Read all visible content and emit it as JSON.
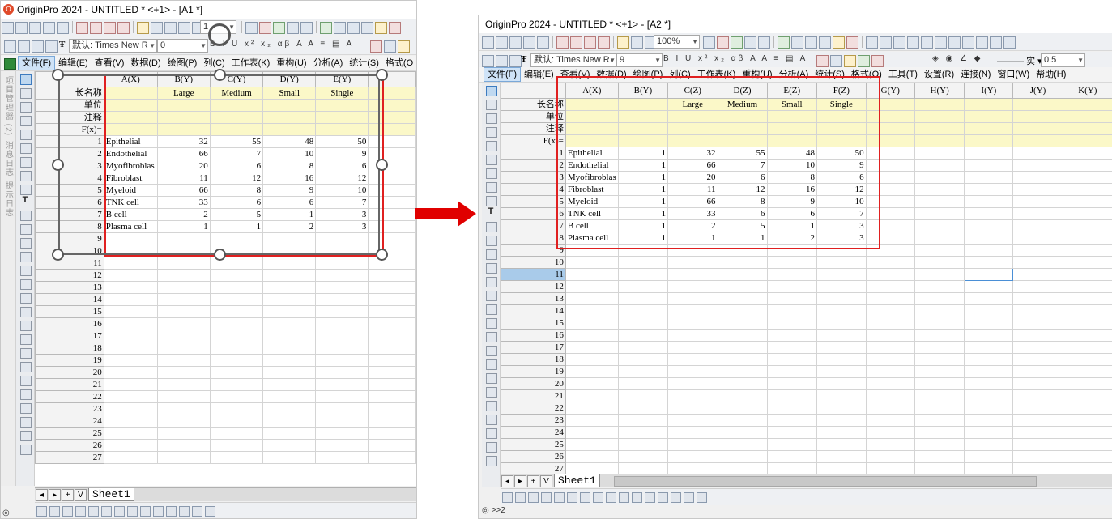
{
  "colors": {
    "arrow": "#e00000",
    "selection_box": "#e02020",
    "meta_row_fill": "#fbf8c8",
    "highlight_column": "#cfe4f7"
  },
  "row_labels": {
    "long_name": "长名称",
    "unit": "单位",
    "comment": "注释",
    "fx": "F(x)="
  },
  "sheet_tab": "Sheet1",
  "left": {
    "title": "OriginPro 2024 - UNTITLED * <+1> - [A1 *]",
    "font_name": "默认: Times New R",
    "font_size": "0",
    "zoom": "1",
    "menus": [
      "文件(F)",
      "编辑(E)",
      "查看(V)",
      "数据(D)",
      "绘图(P)",
      "列(C)",
      "工作表(K)",
      "重构(U)",
      "分析(A)",
      "统计(S)",
      "格式(O"
    ],
    "side_tabs": [
      "项目管理器 (2)",
      "消息日志",
      "提示日志"
    ],
    "columns": [
      {
        "header": "A(X)",
        "long_name": ""
      },
      {
        "header": "B(Y)",
        "long_name": "Large"
      },
      {
        "header": "C(Y)",
        "long_name": "Medium"
      },
      {
        "header": "D(Y)",
        "long_name": "Small"
      },
      {
        "header": "E(Y)",
        "long_name": "Single"
      }
    ],
    "rows": [
      {
        "n": "1",
        "cells": [
          "Epithelial",
          "32",
          "55",
          "48",
          "50"
        ]
      },
      {
        "n": "2",
        "cells": [
          "Endothelial",
          "66",
          "7",
          "10",
          "9"
        ]
      },
      {
        "n": "3",
        "cells": [
          "Myofibroblas",
          "20",
          "6",
          "8",
          "6"
        ]
      },
      {
        "n": "4",
        "cells": [
          "Fibroblast",
          "11",
          "12",
          "16",
          "12"
        ]
      },
      {
        "n": "5",
        "cells": [
          "Myeloid",
          "66",
          "8",
          "9",
          "10"
        ]
      },
      {
        "n": "6",
        "cells": [
          "TNK cell",
          "33",
          "6",
          "6",
          "7"
        ]
      },
      {
        "n": "7",
        "cells": [
          "B cell",
          "2",
          "5",
          "1",
          "3"
        ]
      },
      {
        "n": "8",
        "cells": [
          "Plasma cell",
          "1",
          "1",
          "2",
          "3"
        ]
      }
    ],
    "empty_rows": [
      "9",
      "10",
      "11",
      "12",
      "13",
      "14",
      "15",
      "16",
      "17",
      "18",
      "19",
      "20",
      "21",
      "22",
      "23",
      "24",
      "25",
      "26",
      "27"
    ]
  },
  "right": {
    "title": "OriginPro 2024 - UNTITLED * <+1> - [A2 *]",
    "zoom": "100%",
    "font_name": "默认: Times New R",
    "font_size": "9",
    "line_style": "实",
    "line_width": "0.5",
    "menus": [
      "文件(F)",
      "编辑(E)",
      "查看(V)",
      "数据(D)",
      "绘图(P)",
      "列(C)",
      "工作表(K)",
      "重构(U)",
      "分析(A)",
      "统计(S)",
      "格式(O)",
      "工具(T)",
      "设置(R)",
      "连接(N)",
      "窗口(W)",
      "帮助(H)"
    ],
    "status": ">>2",
    "columns": [
      {
        "header": "A(X)",
        "long_name": ""
      },
      {
        "header": "B(Y)",
        "long_name": ""
      },
      {
        "header": "C(Z)",
        "long_name": "Large"
      },
      {
        "header": "D(Z)",
        "long_name": "Medium"
      },
      {
        "header": "E(Z)",
        "long_name": "Small"
      },
      {
        "header": "F(Z)",
        "long_name": "Single"
      },
      {
        "header": "G(Y)",
        "long_name": ""
      },
      {
        "header": "H(Y)",
        "long_name": ""
      },
      {
        "header": "I(Y)",
        "long_name": ""
      },
      {
        "header": "J(Y)",
        "long_name": ""
      },
      {
        "header": "K(Y)",
        "long_name": ""
      }
    ],
    "rows": [
      {
        "n": "1",
        "cells": [
          "Epithelial",
          "1",
          "32",
          "55",
          "48",
          "50",
          "",
          "",
          "",
          "",
          ""
        ]
      },
      {
        "n": "2",
        "cells": [
          "Endothelial",
          "1",
          "66",
          "7",
          "10",
          "9",
          "",
          "",
          "",
          "",
          ""
        ]
      },
      {
        "n": "3",
        "cells": [
          "Myofibroblas",
          "1",
          "20",
          "6",
          "8",
          "6",
          "",
          "",
          "",
          "",
          ""
        ]
      },
      {
        "n": "4",
        "cells": [
          "Fibroblast",
          "1",
          "11",
          "12",
          "16",
          "12",
          "",
          "",
          "",
          "",
          ""
        ]
      },
      {
        "n": "5",
        "cells": [
          "Myeloid",
          "1",
          "66",
          "8",
          "9",
          "10",
          "",
          "",
          "",
          "",
          ""
        ]
      },
      {
        "n": "6",
        "cells": [
          "TNK cell",
          "1",
          "33",
          "6",
          "6",
          "7",
          "",
          "",
          "",
          "",
          ""
        ]
      },
      {
        "n": "7",
        "cells": [
          "B cell",
          "1",
          "2",
          "5",
          "1",
          "3",
          "",
          "",
          "",
          "",
          ""
        ]
      },
      {
        "n": "8",
        "cells": [
          "Plasma cell",
          "1",
          "1",
          "1",
          "2",
          "3",
          "",
          "",
          "",
          "",
          ""
        ]
      }
    ],
    "empty_rows": [
      "9",
      "10",
      "11",
      "12",
      "13",
      "14",
      "15",
      "16",
      "17",
      "18",
      "19",
      "20",
      "21",
      "22",
      "23",
      "24",
      "25",
      "26",
      "27"
    ]
  }
}
